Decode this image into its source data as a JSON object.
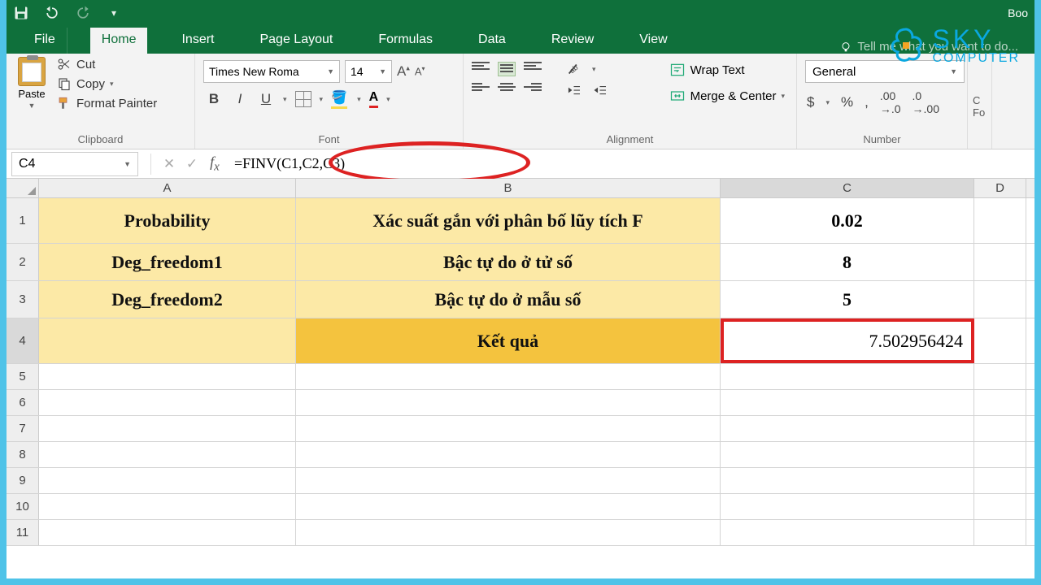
{
  "titlebar": {
    "doc": "Boo"
  },
  "menu": {
    "file": "File",
    "home": "Home",
    "insert": "Insert",
    "page_layout": "Page Layout",
    "formulas": "Formulas",
    "data": "Data",
    "review": "Review",
    "view": "View",
    "tell_me": "Tell me what you want to do..."
  },
  "ribbon": {
    "clipboard": {
      "label": "Clipboard",
      "paste": "Paste",
      "cut": "Cut",
      "copy": "Copy",
      "painter": "Format Painter"
    },
    "font": {
      "label": "Font",
      "name": "Times New Roma",
      "size": "14"
    },
    "alignment": {
      "label": "Alignment",
      "wrap": "Wrap Text",
      "merge": "Merge & Center"
    },
    "number": {
      "label": "Number",
      "format": "General"
    },
    "truncated": "C\nFo"
  },
  "fbar": {
    "name": "C4",
    "formula": "=FINV(C1,C2,C3)"
  },
  "columns": {
    "a": "A",
    "b": "B",
    "c": "C",
    "d": "D"
  },
  "rows": [
    "1",
    "2",
    "3",
    "4",
    "5",
    "6",
    "7",
    "8",
    "9",
    "10",
    "11"
  ],
  "cells": {
    "a1": "Probability",
    "b1": "Xác suất gắn với phân bố lũy tích F",
    "c1": "0.02",
    "a2": "Deg_freedom1",
    "b2": "Bậc tự do ở tử số",
    "c2": "8",
    "a3": "Deg_freedom2",
    "b3": "Bậc tự do ở mẫu số",
    "c3": "5",
    "b4": "Kết quả",
    "c4": "7.502956424"
  },
  "logo": {
    "sky": "SKY",
    "computer": "COMPUTER"
  }
}
